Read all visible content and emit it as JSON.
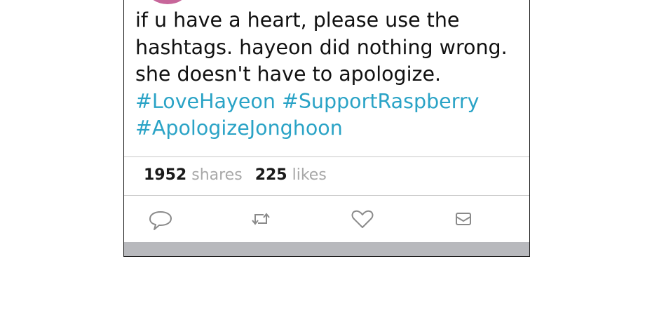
{
  "tweet": {
    "lines": [
      "if u have a heart, please use the",
      "hashtags. hayeon did nothing wrong.",
      "she doesn't have to apologize."
    ],
    "hashtags": [
      "#LoveHayeon",
      "#SupportRaspberry",
      "#ApologizeJonghoon"
    ]
  },
  "stats": {
    "shares_count": "1952",
    "shares_label": "shares",
    "likes_count": "225",
    "likes_label": "likes"
  },
  "actions": {
    "reply": "comment-bubble-icon",
    "retweet": "retweet-icon",
    "like": "heart-icon",
    "message": "envelope-icon"
  },
  "colors": {
    "hashtag": "#2aa3c6",
    "icon": "#8a8a8a",
    "bottom_bar": "#b8b9bd"
  }
}
